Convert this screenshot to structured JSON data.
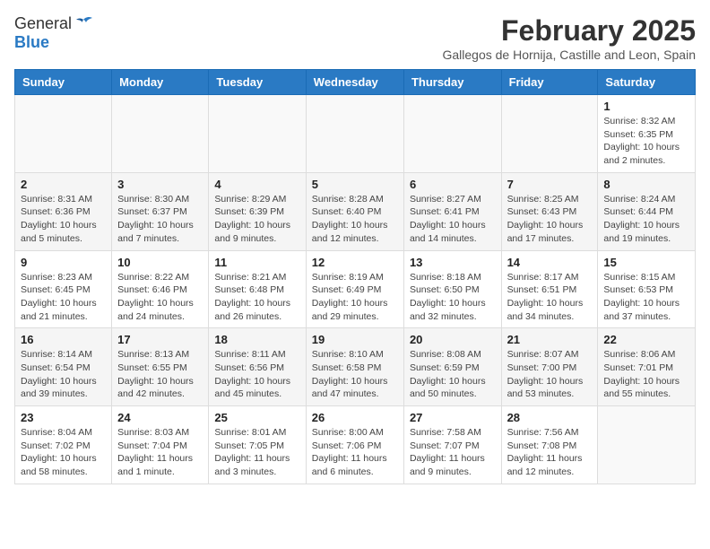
{
  "logo": {
    "general": "General",
    "blue": "Blue"
  },
  "title": {
    "month_year": "February 2025",
    "location": "Gallegos de Hornija, Castille and Leon, Spain"
  },
  "weekdays": [
    "Sunday",
    "Monday",
    "Tuesday",
    "Wednesday",
    "Thursday",
    "Friday",
    "Saturday"
  ],
  "weeks": [
    [
      {
        "day": "",
        "info": ""
      },
      {
        "day": "",
        "info": ""
      },
      {
        "day": "",
        "info": ""
      },
      {
        "day": "",
        "info": ""
      },
      {
        "day": "",
        "info": ""
      },
      {
        "day": "",
        "info": ""
      },
      {
        "day": "1",
        "info": "Sunrise: 8:32 AM\nSunset: 6:35 PM\nDaylight: 10 hours and 2 minutes."
      }
    ],
    [
      {
        "day": "2",
        "info": "Sunrise: 8:31 AM\nSunset: 6:36 PM\nDaylight: 10 hours and 5 minutes."
      },
      {
        "day": "3",
        "info": "Sunrise: 8:30 AM\nSunset: 6:37 PM\nDaylight: 10 hours and 7 minutes."
      },
      {
        "day": "4",
        "info": "Sunrise: 8:29 AM\nSunset: 6:39 PM\nDaylight: 10 hours and 9 minutes."
      },
      {
        "day": "5",
        "info": "Sunrise: 8:28 AM\nSunset: 6:40 PM\nDaylight: 10 hours and 12 minutes."
      },
      {
        "day": "6",
        "info": "Sunrise: 8:27 AM\nSunset: 6:41 PM\nDaylight: 10 hours and 14 minutes."
      },
      {
        "day": "7",
        "info": "Sunrise: 8:25 AM\nSunset: 6:43 PM\nDaylight: 10 hours and 17 minutes."
      },
      {
        "day": "8",
        "info": "Sunrise: 8:24 AM\nSunset: 6:44 PM\nDaylight: 10 hours and 19 minutes."
      }
    ],
    [
      {
        "day": "9",
        "info": "Sunrise: 8:23 AM\nSunset: 6:45 PM\nDaylight: 10 hours and 21 minutes."
      },
      {
        "day": "10",
        "info": "Sunrise: 8:22 AM\nSunset: 6:46 PM\nDaylight: 10 hours and 24 minutes."
      },
      {
        "day": "11",
        "info": "Sunrise: 8:21 AM\nSunset: 6:48 PM\nDaylight: 10 hours and 26 minutes."
      },
      {
        "day": "12",
        "info": "Sunrise: 8:19 AM\nSunset: 6:49 PM\nDaylight: 10 hours and 29 minutes."
      },
      {
        "day": "13",
        "info": "Sunrise: 8:18 AM\nSunset: 6:50 PM\nDaylight: 10 hours and 32 minutes."
      },
      {
        "day": "14",
        "info": "Sunrise: 8:17 AM\nSunset: 6:51 PM\nDaylight: 10 hours and 34 minutes."
      },
      {
        "day": "15",
        "info": "Sunrise: 8:15 AM\nSunset: 6:53 PM\nDaylight: 10 hours and 37 minutes."
      }
    ],
    [
      {
        "day": "16",
        "info": "Sunrise: 8:14 AM\nSunset: 6:54 PM\nDaylight: 10 hours and 39 minutes."
      },
      {
        "day": "17",
        "info": "Sunrise: 8:13 AM\nSunset: 6:55 PM\nDaylight: 10 hours and 42 minutes."
      },
      {
        "day": "18",
        "info": "Sunrise: 8:11 AM\nSunset: 6:56 PM\nDaylight: 10 hours and 45 minutes."
      },
      {
        "day": "19",
        "info": "Sunrise: 8:10 AM\nSunset: 6:58 PM\nDaylight: 10 hours and 47 minutes."
      },
      {
        "day": "20",
        "info": "Sunrise: 8:08 AM\nSunset: 6:59 PM\nDaylight: 10 hours and 50 minutes."
      },
      {
        "day": "21",
        "info": "Sunrise: 8:07 AM\nSunset: 7:00 PM\nDaylight: 10 hours and 53 minutes."
      },
      {
        "day": "22",
        "info": "Sunrise: 8:06 AM\nSunset: 7:01 PM\nDaylight: 10 hours and 55 minutes."
      }
    ],
    [
      {
        "day": "23",
        "info": "Sunrise: 8:04 AM\nSunset: 7:02 PM\nDaylight: 10 hours and 58 minutes."
      },
      {
        "day": "24",
        "info": "Sunrise: 8:03 AM\nSunset: 7:04 PM\nDaylight: 11 hours and 1 minute."
      },
      {
        "day": "25",
        "info": "Sunrise: 8:01 AM\nSunset: 7:05 PM\nDaylight: 11 hours and 3 minutes."
      },
      {
        "day": "26",
        "info": "Sunrise: 8:00 AM\nSunset: 7:06 PM\nDaylight: 11 hours and 6 minutes."
      },
      {
        "day": "27",
        "info": "Sunrise: 7:58 AM\nSunset: 7:07 PM\nDaylight: 11 hours and 9 minutes."
      },
      {
        "day": "28",
        "info": "Sunrise: 7:56 AM\nSunset: 7:08 PM\nDaylight: 11 hours and 12 minutes."
      },
      {
        "day": "",
        "info": ""
      }
    ]
  ]
}
